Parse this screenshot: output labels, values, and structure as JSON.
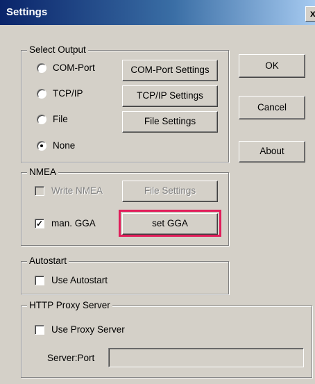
{
  "window": {
    "title": "Settings",
    "close_label": "x"
  },
  "select_output": {
    "legend": "Select Output",
    "radios": [
      {
        "label": "COM-Port",
        "selected": false
      },
      {
        "label": "TCP/IP",
        "selected": false
      },
      {
        "label": "File",
        "selected": false
      },
      {
        "label": "None",
        "selected": true
      }
    ],
    "buttons": [
      "COM-Port Settings",
      "TCP/IP Settings",
      "File Settings"
    ]
  },
  "dialog_buttons": {
    "ok": "OK",
    "cancel": "Cancel",
    "about": "About"
  },
  "nmea": {
    "legend": "NMEA",
    "write_nmea": {
      "label": "Write NMEA",
      "checked": false,
      "enabled": false
    },
    "file_settings": "File Settings",
    "man_gga": {
      "label": "man. GGA",
      "checked": true
    },
    "set_gga": "set GGA",
    "highlight_color": "#e11d5a"
  },
  "autostart": {
    "legend": "Autostart",
    "use_autostart": {
      "label": "Use Autostart",
      "checked": false
    }
  },
  "http_proxy": {
    "legend": "HTTP Proxy Server",
    "use_proxy": {
      "label": "Use Proxy Server",
      "checked": false
    },
    "server_port_label": "Server:Port",
    "server_port_value": ""
  }
}
